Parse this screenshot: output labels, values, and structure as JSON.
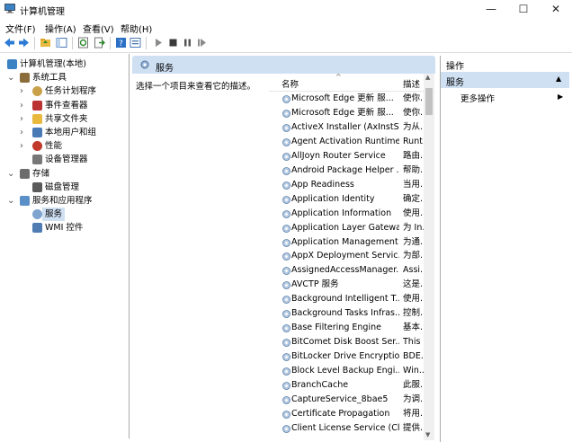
{
  "window": {
    "title": "计算机管理",
    "minimize": "—",
    "maximize": "☐",
    "close": "✕"
  },
  "menu": [
    "文件(F)",
    "操作(A)",
    "查看(V)",
    "帮助(H)"
  ],
  "toolbar_icons": [
    "back-icon",
    "forward-icon",
    "up-folder-icon",
    "show-hide-tree-icon",
    "refresh-icon",
    "export-icon",
    "help-icon",
    "properties-icon",
    "play-icon",
    "stop-icon",
    "pause-icon",
    "restart-icon"
  ],
  "tree": [
    {
      "label": "计算机管理(本地)",
      "indent": 0,
      "expander": "",
      "icon": "computer-icon"
    },
    {
      "label": "系统工具",
      "indent": 1,
      "expander": "v",
      "icon": "tools-icon"
    },
    {
      "label": "任务计划程序",
      "indent": 2,
      "expander": ">",
      "icon": "clock-icon"
    },
    {
      "label": "事件查看器",
      "indent": 2,
      "expander": ">",
      "icon": "event-icon"
    },
    {
      "label": "共享文件夹",
      "indent": 2,
      "expander": ">",
      "icon": "share-folder-icon"
    },
    {
      "label": "本地用户和组",
      "indent": 2,
      "expander": ">",
      "icon": "users-icon"
    },
    {
      "label": "性能",
      "indent": 2,
      "expander": ">",
      "icon": "performance-icon"
    },
    {
      "label": "设备管理器",
      "indent": 2,
      "expander": "",
      "icon": "device-icon"
    },
    {
      "label": "存储",
      "indent": 1,
      "expander": "v",
      "icon": "storage-icon"
    },
    {
      "label": "磁盘管理",
      "indent": 2,
      "expander": "",
      "icon": "disk-icon"
    },
    {
      "label": "服务和应用程序",
      "indent": 1,
      "expander": "v",
      "icon": "services-apps-icon"
    },
    {
      "label": "服务",
      "indent": 2,
      "expander": "",
      "icon": "service-gear-icon",
      "selected": true
    },
    {
      "label": "WMI 控件",
      "indent": 2,
      "expander": "",
      "icon": "wmi-icon"
    }
  ],
  "center": {
    "header": "服务",
    "description_prompt": "选择一个项目来查看它的描述。",
    "col_name": "名称",
    "col_desc": "描述",
    "sort_arrow": "^"
  },
  "services": [
    {
      "name": "Microsoft Edge 更新 服...",
      "desc": "使你..."
    },
    {
      "name": "Microsoft Edge 更新 服...",
      "desc": "使你..."
    },
    {
      "name": "ActiveX Installer (AxInstSV)",
      "desc": "为从..."
    },
    {
      "name": "Agent Activation Runtime...",
      "desc": "Runt..."
    },
    {
      "name": "AllJoyn Router Service",
      "desc": "路由..."
    },
    {
      "name": "Android Package Helper ...",
      "desc": "帮助..."
    },
    {
      "name": "App Readiness",
      "desc": "当用..."
    },
    {
      "name": "Application Identity",
      "desc": "确定..."
    },
    {
      "name": "Application Information",
      "desc": "使用..."
    },
    {
      "name": "Application Layer Gatewa...",
      "desc": "为 In..."
    },
    {
      "name": "Application Management",
      "desc": "为通..."
    },
    {
      "name": "AppX Deployment Servic...",
      "desc": "为部..."
    },
    {
      "name": "AssignedAccessManager...",
      "desc": "Assi..."
    },
    {
      "name": "AVCTP 服务",
      "desc": "这是..."
    },
    {
      "name": "Background Intelligent T...",
      "desc": "使用..."
    },
    {
      "name": "Background Tasks Infras...",
      "desc": "控制..."
    },
    {
      "name": "Base Filtering Engine",
      "desc": "基本..."
    },
    {
      "name": "BitComet Disk Boost Ser...",
      "desc": "This ..."
    },
    {
      "name": "BitLocker Drive Encryptio...",
      "desc": "BDE..."
    },
    {
      "name": "Block Level Backup Engi...",
      "desc": "Win..."
    },
    {
      "name": "BranchCache",
      "desc": "此服..."
    },
    {
      "name": "CaptureService_8bae5",
      "desc": "为调..."
    },
    {
      "name": "Certificate Propagation",
      "desc": "将用..."
    },
    {
      "name": "Client License Service (Cli...",
      "desc": "提供..."
    }
  ],
  "actions": {
    "title": "操作",
    "selected": "服务",
    "more": "更多操作",
    "collapse_arrow": "▲",
    "more_arrow": "▶"
  },
  "colors": {
    "header_bg": "#cfe0f3",
    "selection_bg": "#cfe0f3",
    "accent": "#1e6fd9"
  }
}
